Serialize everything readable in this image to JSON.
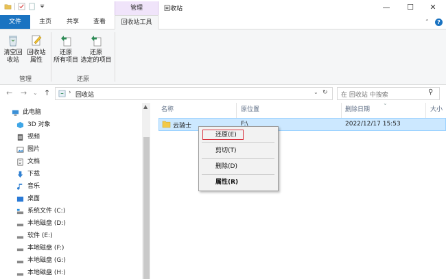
{
  "window": {
    "title": "回收站",
    "context_tab_title": "管理"
  },
  "tabs": [
    {
      "label": "文件"
    },
    {
      "label": "主页"
    },
    {
      "label": "共享"
    },
    {
      "label": "查看"
    },
    {
      "label": "回收站工具"
    }
  ],
  "ribbon": {
    "groups": [
      {
        "label": "管理",
        "buttons": [
          {
            "line1": "清空回",
            "line2": "收站"
          },
          {
            "line1": "回收站",
            "line2": "属性"
          }
        ]
      },
      {
        "label": "还原",
        "buttons": [
          {
            "line1": "还原",
            "line2": "所有项目"
          },
          {
            "line1": "还原",
            "line2": "选定的项目"
          }
        ]
      }
    ]
  },
  "address": {
    "path": "回收站",
    "search_placeholder": "在 回收站 中搜索"
  },
  "nav_pane": {
    "items": [
      {
        "label": "此电脑",
        "icon": "pc-icon"
      },
      {
        "label": "3D 对象",
        "icon": "3d-objects-icon"
      },
      {
        "label": "视频",
        "icon": "video-icon"
      },
      {
        "label": "图片",
        "icon": "pictures-icon"
      },
      {
        "label": "文档",
        "icon": "documents-icon"
      },
      {
        "label": "下载",
        "icon": "download-icon"
      },
      {
        "label": "音乐",
        "icon": "music-icon"
      },
      {
        "label": "桌面",
        "icon": "desktop-icon"
      },
      {
        "label": "系统文件 (C:)",
        "icon": "system-drive-icon"
      },
      {
        "label": "本地磁盘 (D:)",
        "icon": "drive-icon"
      },
      {
        "label": "软件 (E:)",
        "icon": "drive-icon"
      },
      {
        "label": "本地磁盘 (F:)",
        "icon": "drive-icon"
      },
      {
        "label": "本地磁盘 (G:)",
        "icon": "drive-icon"
      },
      {
        "label": "本地磁盘 (H:)",
        "icon": "drive-icon"
      }
    ]
  },
  "columns": [
    {
      "label": "名称"
    },
    {
      "label": "原位置"
    },
    {
      "label": "删除日期"
    },
    {
      "label": "大小"
    }
  ],
  "rows": [
    {
      "name": "云骑士",
      "location": "F:\\",
      "deleted": "2022/12/17 15:53"
    }
  ],
  "context_menu": {
    "items": [
      {
        "label": "还原(E)"
      },
      {
        "label": "剪切(T)"
      },
      {
        "label": "删除(D)"
      },
      {
        "label": "属性(R)"
      }
    ]
  },
  "colors": {
    "accent": "#1a73c1",
    "selection": "#cce8ff",
    "context_tab": "#f0e4fa",
    "highlight_border": "#d9333f"
  }
}
